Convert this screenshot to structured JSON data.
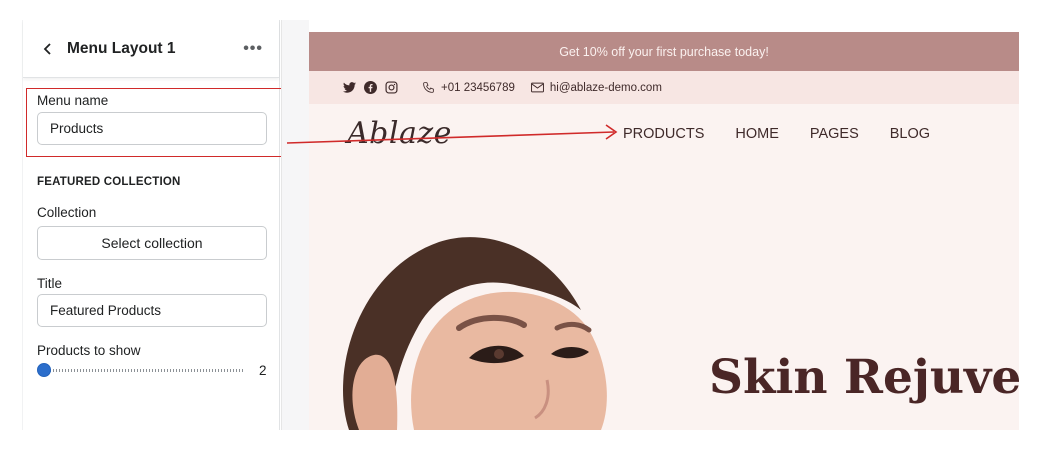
{
  "panel": {
    "title": "Menu Layout 1",
    "more_label": "•••",
    "menu_name_label": "Menu name",
    "menu_name_value": "Products",
    "section_heading": "FEATURED COLLECTION",
    "collection_label": "Collection",
    "select_collection_label": "Select collection",
    "title_label": "Title",
    "title_value": "Featured Products",
    "products_to_show_label": "Products to show",
    "products_to_show_value": "2",
    "products_to_show_fraction": 0.0
  },
  "preview": {
    "announcement": "Get 10% off your first purchase today!",
    "phone": "+01 23456789",
    "email": "hi@ablaze-demo.com",
    "logo": "Ablaze",
    "nav": [
      "PRODUCTS",
      "HOME",
      "PAGES",
      "BLOG"
    ],
    "hero_title": "Skin Rejuven",
    "social_icons": [
      "twitter-icon",
      "facebook-icon",
      "instagram-icon"
    ]
  },
  "colors": {
    "accent": "#2c6ecb",
    "announcement_bg": "#b88b88",
    "highlight": "#d02a2a",
    "hero_text": "#4a2626"
  }
}
